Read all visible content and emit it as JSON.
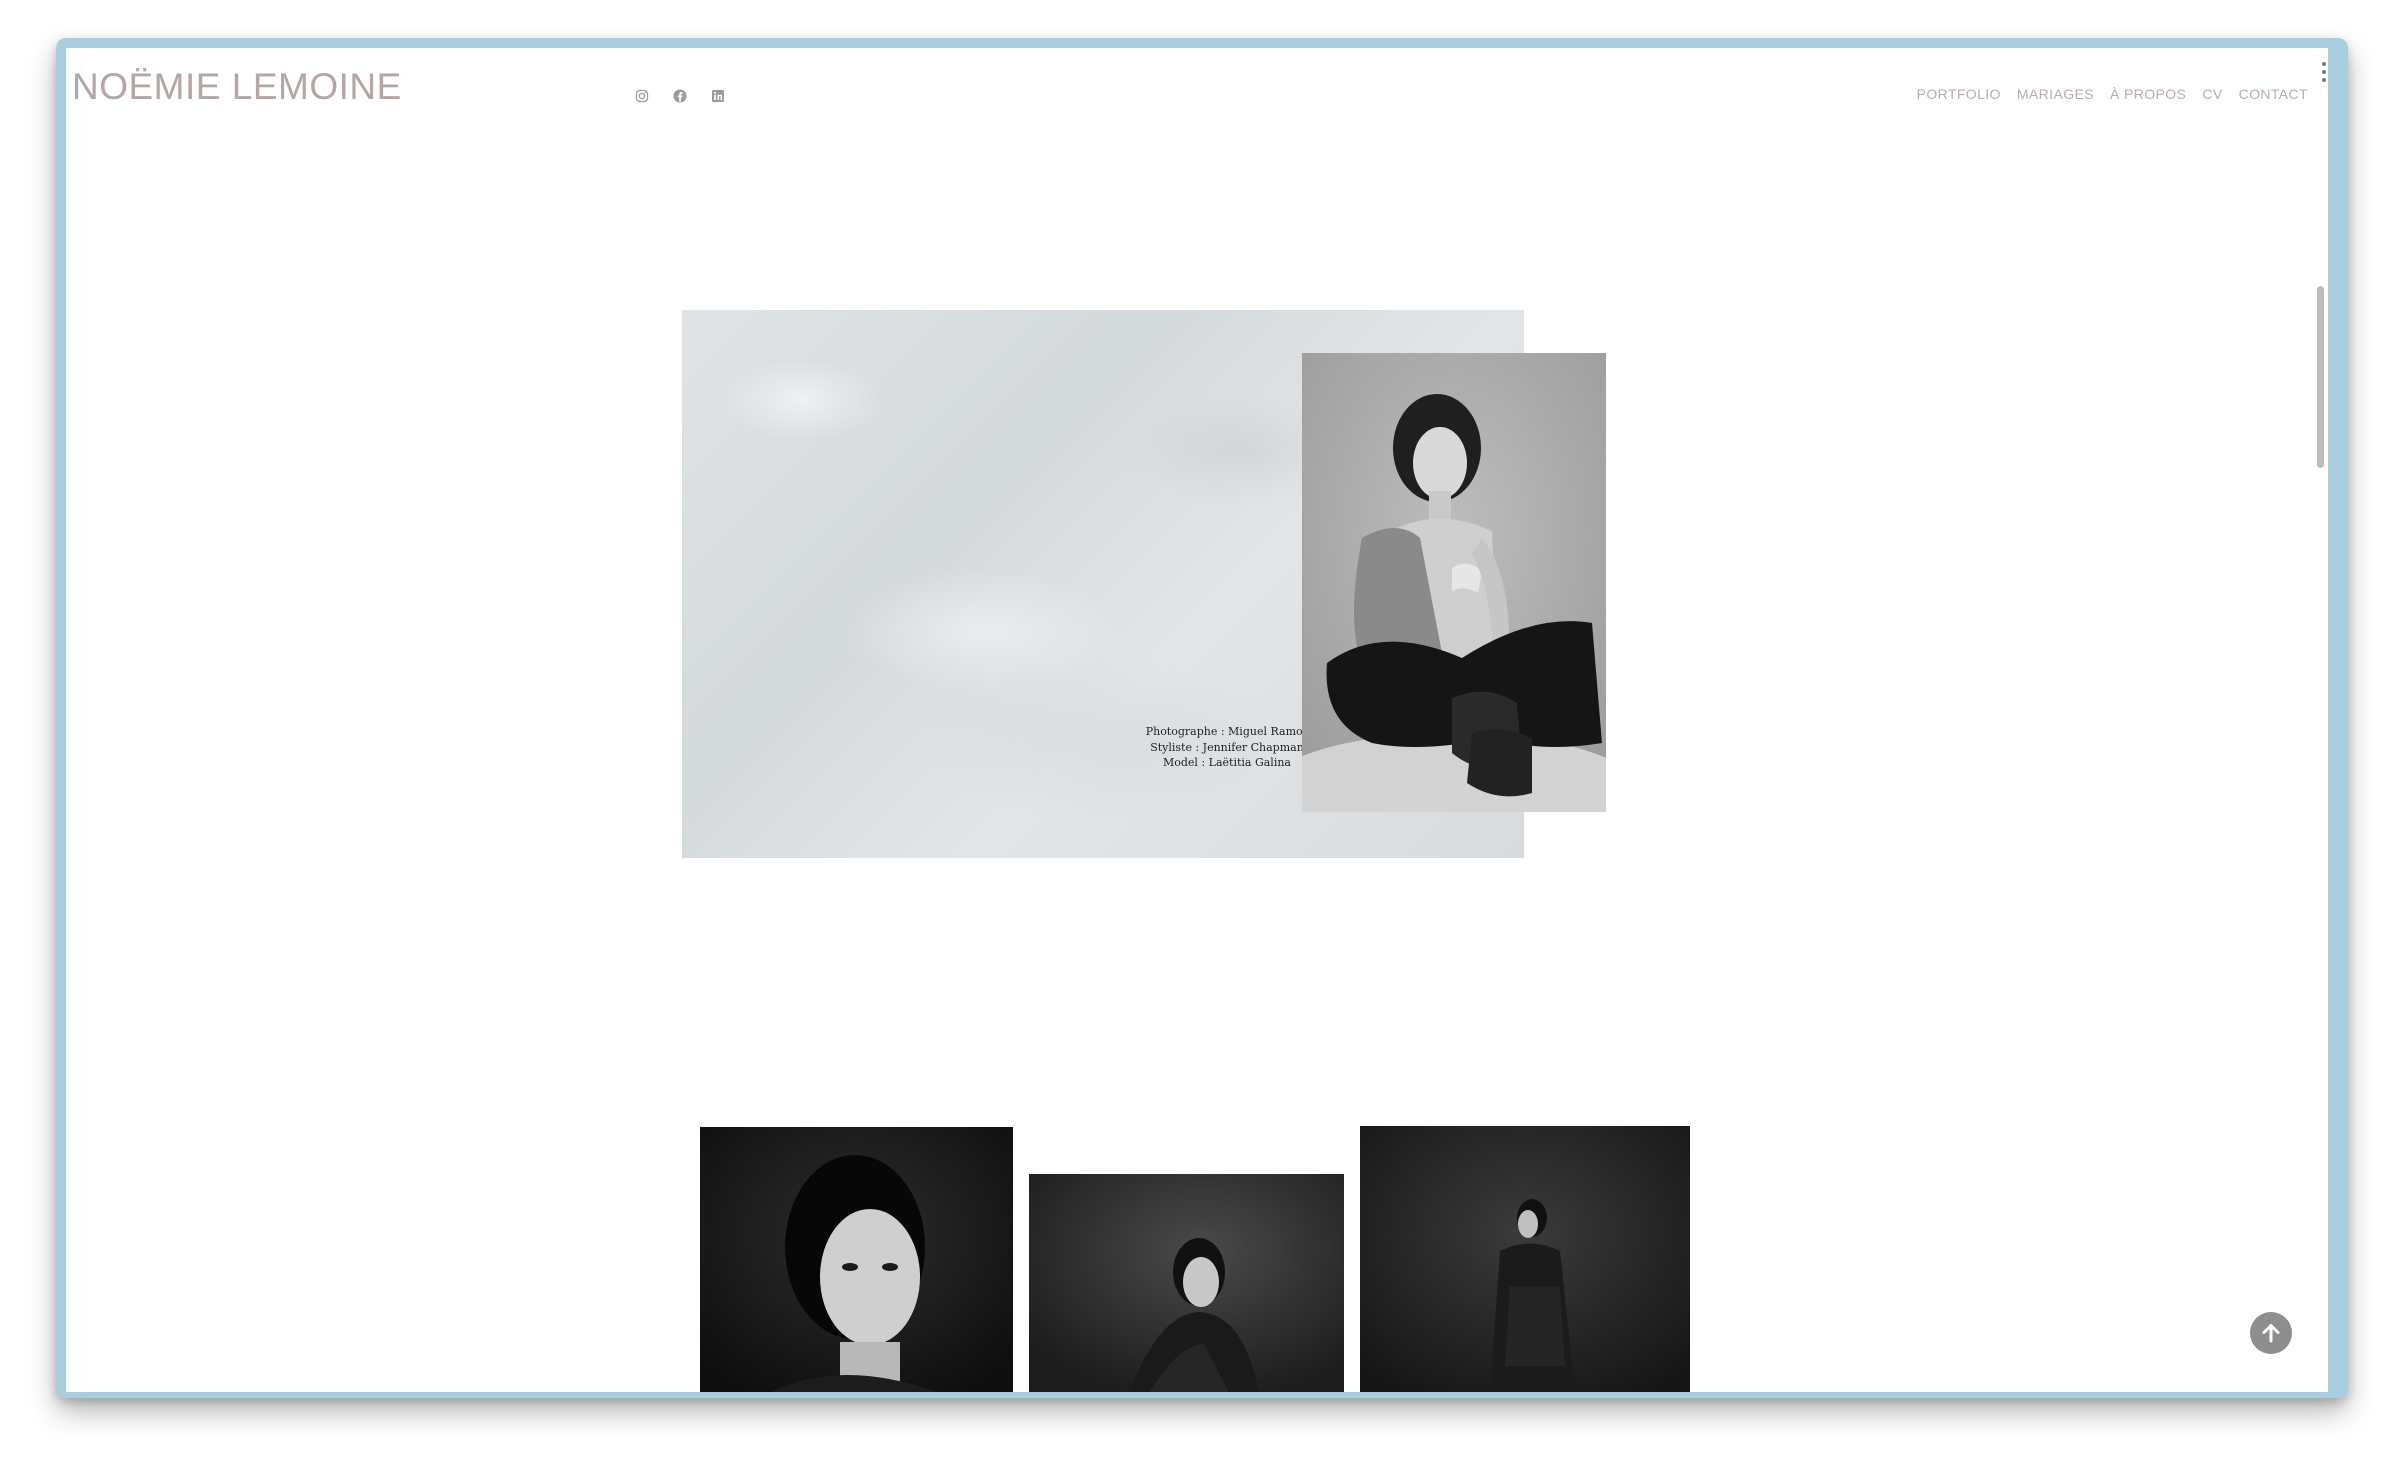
{
  "site": {
    "title": "NOËMIE LEMOINE"
  },
  "social": [
    {
      "icon": "instagram-icon",
      "name": "Instagram"
    },
    {
      "icon": "facebook-icon",
      "name": "Facebook"
    },
    {
      "icon": "linkedin-icon",
      "name": "LinkedIn"
    }
  ],
  "nav": {
    "items": [
      {
        "label": "PORTFOLIO"
      },
      {
        "label": "MARIAGES"
      },
      {
        "label": "À PROPOS"
      },
      {
        "label": "CV"
      },
      {
        "label": "CONTACT"
      }
    ]
  },
  "hero": {
    "credits": [
      "Photographe : Miguel Ramos",
      "Styliste : Jennifer Chapman",
      "Model : Laëtitia Galina"
    ]
  },
  "gallery": {
    "items": [
      {
        "subject": "close-up portrait of model"
      },
      {
        "subject": "seated model in plaid jacket"
      },
      {
        "subject": "full-length model in plaid coat"
      }
    ]
  },
  "ui": {
    "back_to_top_icon": "arrow-up-icon"
  },
  "colors": {
    "frame": "#a9cedd",
    "title": "#b3a6a3",
    "nav": "#b9acaa",
    "back_to_top": "#8e8e8e"
  }
}
